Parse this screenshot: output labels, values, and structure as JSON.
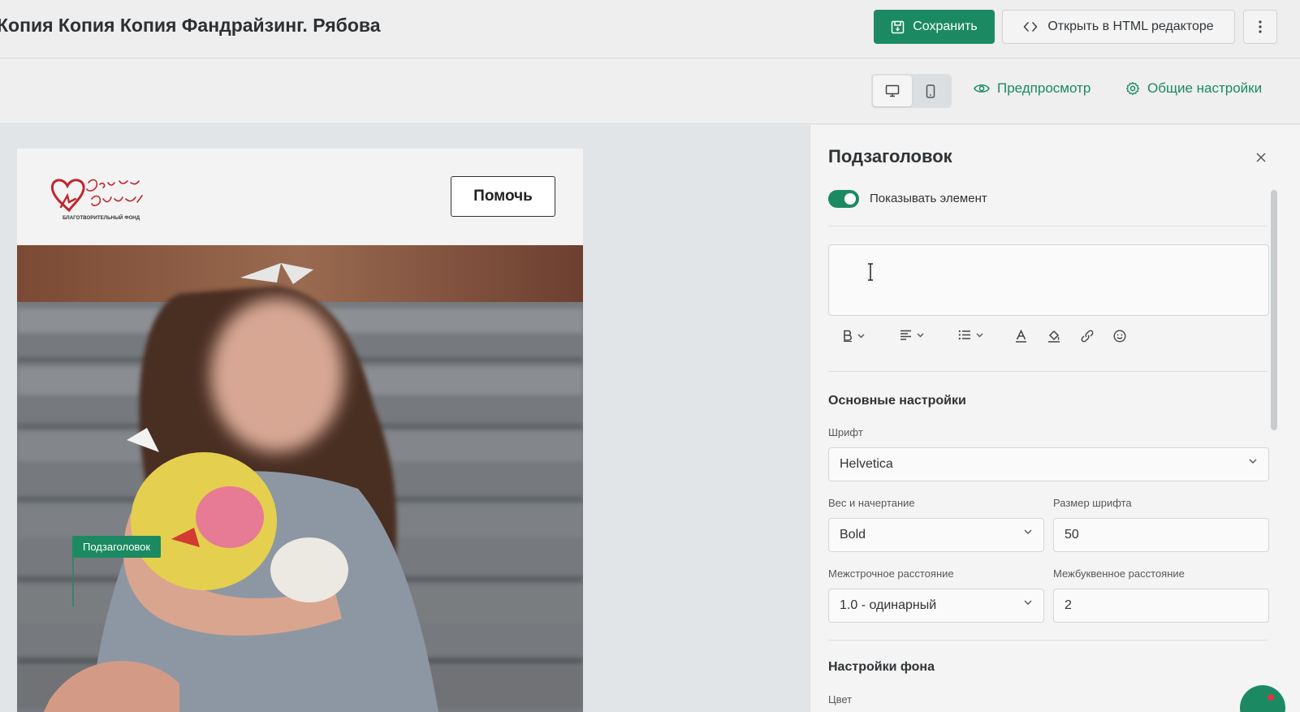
{
  "header": {
    "title": "Копия Копия Копия Фандрайзинг. Рябова",
    "save_label": "Сохранить",
    "html_editor_label": "Открыть в HTML редакторе",
    "more_icon": "more-vertical-icon"
  },
  "toolbar": {
    "devices": [
      {
        "name": "desktop",
        "active": true
      },
      {
        "name": "mobile",
        "active": false
      }
    ],
    "preview_label": "Предпросмотр",
    "settings_label": "Общие настройки"
  },
  "email": {
    "logo_caption": "БЛАГОТВОРИТЕЛЬНЫЙ ФОНД",
    "help_button": "Помочь",
    "subtitle_tag": "Подзаголовок"
  },
  "panel": {
    "title": "Подзаголовок",
    "toggle_label": "Показывать элемент",
    "toggle_on": true,
    "basic_section": "Основные настройки",
    "font_label": "Шрифт",
    "font_value": "Helvetica",
    "weight_label": "Вес и начертание",
    "weight_value": "Bold",
    "size_label": "Размер шрифта",
    "size_value": "50",
    "line_height_label": "Межстрочное расстояние",
    "line_height_value": "1.0 - одинарный",
    "letter_spacing_label": "Межбуквенное расстояние",
    "letter_spacing_value": "2",
    "bg_section": "Настройки фона",
    "color_label": "Цвет"
  },
  "colors": {
    "accent": "#1b8a62",
    "logo_red": "#c0262d"
  }
}
